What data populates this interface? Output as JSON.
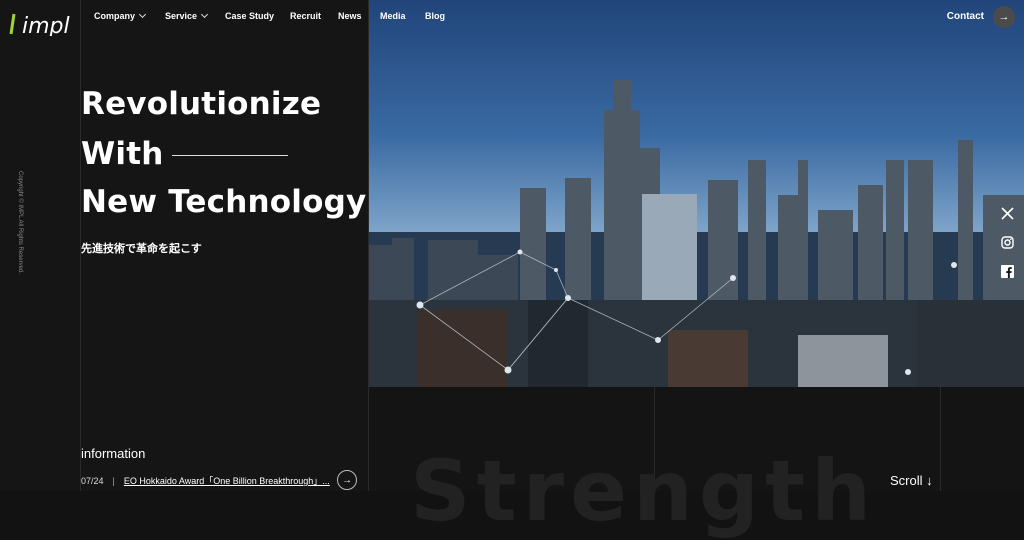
{
  "brand": {
    "logo_text": "impl"
  },
  "nav": {
    "items": [
      {
        "label": "Company",
        "has_dropdown": true
      },
      {
        "label": "Service",
        "has_dropdown": true
      },
      {
        "label": "Case Study"
      },
      {
        "label": "Recruit"
      },
      {
        "label": "News"
      },
      {
        "label": "Media"
      },
      {
        "label": "Blog"
      }
    ],
    "contact_label": "Contact"
  },
  "hero": {
    "line1": "Revolutionize",
    "line2": "With",
    "line3": "New Technology",
    "subtitle": "先進技術で革命を起こす"
  },
  "copyright": "Copyright © IMPL All Rights Reserved.",
  "information": {
    "label": "information",
    "items": [
      {
        "date": "07/24",
        "separator": "|",
        "title": "EO Hokkaido Award「One Billion Breakthrough」..."
      }
    ]
  },
  "scroll_label": "Scroll",
  "background_word": "Strength",
  "social": [
    "x-icon",
    "instagram-icon",
    "facebook-icon"
  ],
  "colors": {
    "background": "#121212",
    "panel": "#151515",
    "text": "#ffffff",
    "accent_green": "#9fd63a"
  }
}
